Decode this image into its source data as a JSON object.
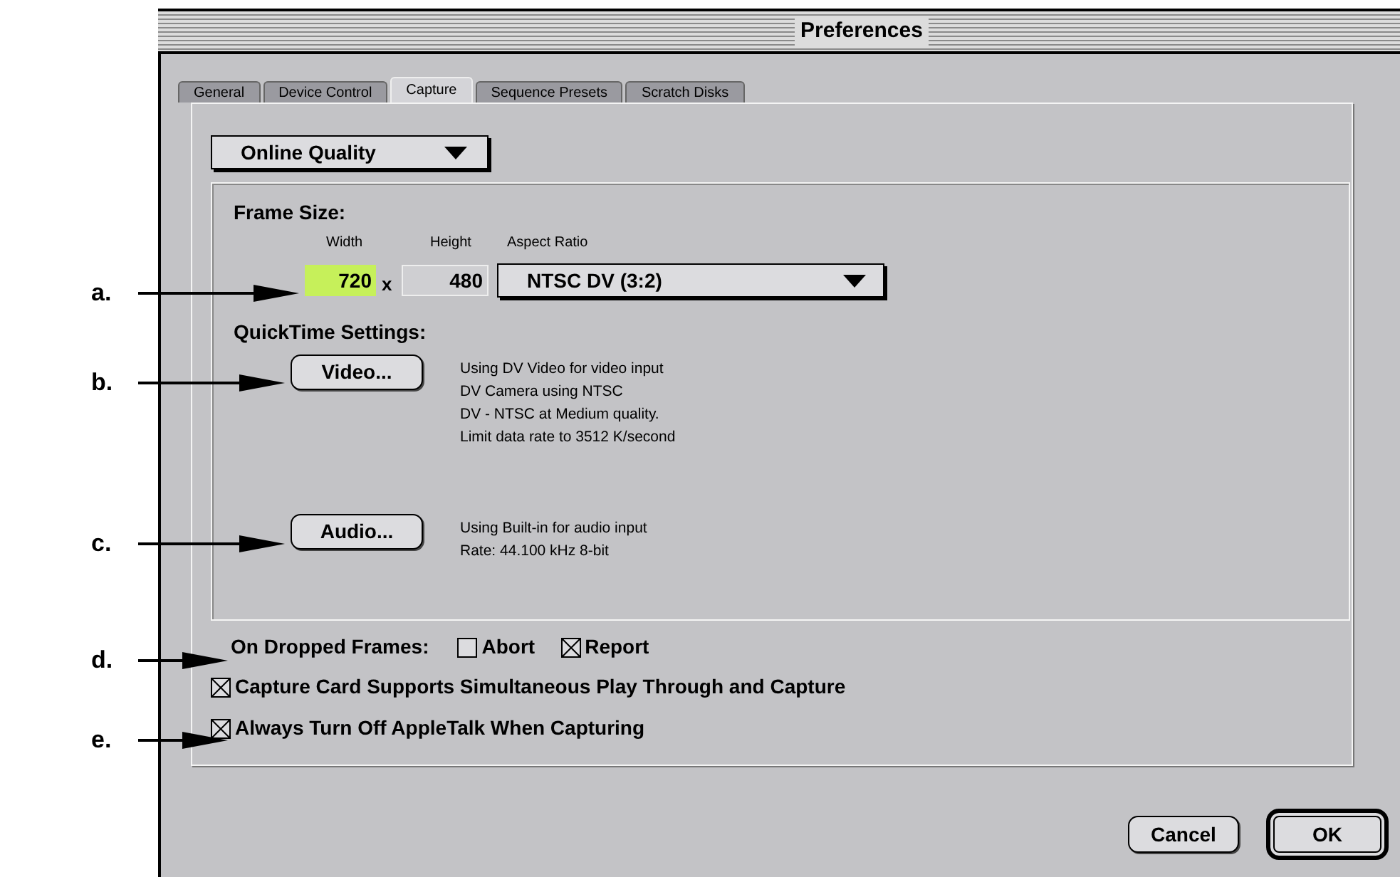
{
  "window": {
    "title": "Preferences"
  },
  "tabs": [
    {
      "label": "General",
      "selected": false
    },
    {
      "label": "Device Control",
      "selected": false
    },
    {
      "label": "Capture",
      "selected": true
    },
    {
      "label": "Sequence Presets",
      "selected": false
    },
    {
      "label": "Scratch Disks",
      "selected": false
    }
  ],
  "preset_dropdown": {
    "value": "Online Quality"
  },
  "frame_size": {
    "heading": "Frame Size:",
    "width_label": "Width",
    "width_value": "720",
    "times": "x",
    "height_label": "Height",
    "height_value": "480",
    "aspect_label": "Aspect Ratio",
    "aspect_value": "NTSC DV (3:2)"
  },
  "quicktime": {
    "heading": "QuickTime Settings:",
    "video_button": "Video...",
    "video_info": [
      "Using DV Video for video input",
      "DV Camera using NTSC",
      "DV - NTSC at Medium quality.",
      "Limit data rate to 3512 K/second"
    ],
    "audio_button": "Audio...",
    "audio_info": [
      "Using Built-in for audio input",
      "Rate: 44.100 kHz 8-bit"
    ]
  },
  "dropped_frames": {
    "label": "On Dropped Frames:",
    "options": [
      {
        "label": "Abort",
        "checked": false
      },
      {
        "label": "Report",
        "checked": true
      }
    ]
  },
  "checkboxes": [
    {
      "label": "Capture Card Supports Simultaneous Play Through and Capture",
      "checked": true
    },
    {
      "label": "Always Turn Off AppleTalk When Capturing",
      "checked": true
    }
  ],
  "buttons": [
    "Cancel",
    "OK"
  ],
  "callouts": [
    "a.",
    "b.",
    "c.",
    "d.",
    "e."
  ]
}
